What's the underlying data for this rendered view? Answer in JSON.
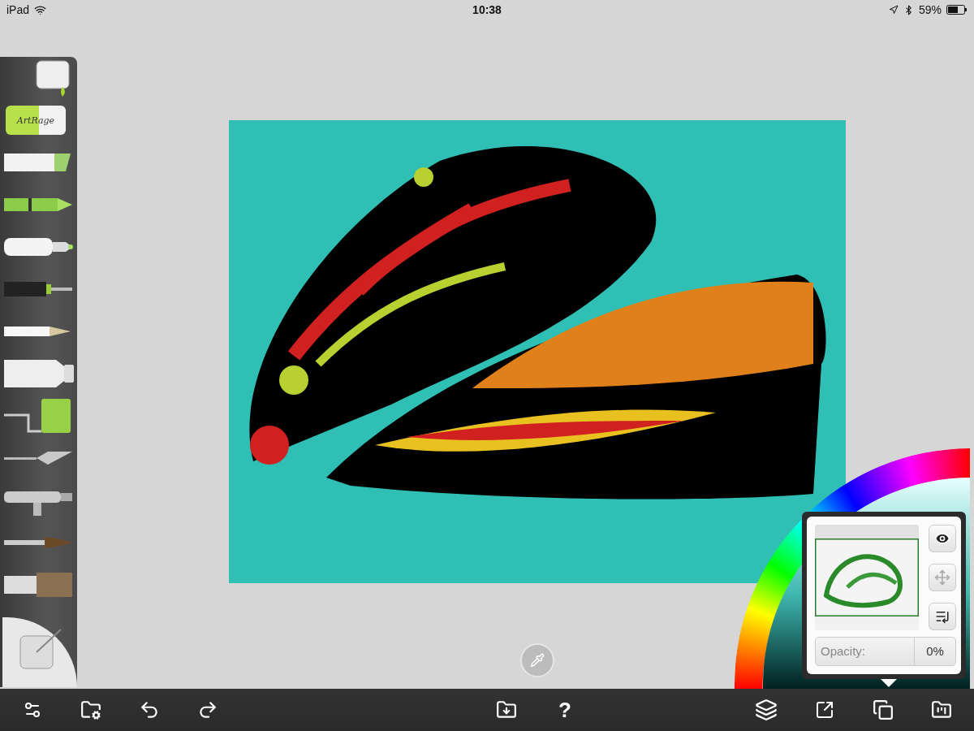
{
  "status_bar": {
    "device": "iPad",
    "time": "10:38",
    "battery": "59%"
  },
  "tools": [
    {
      "kind": "bucket"
    },
    {
      "kind": "eraser",
      "label": "ArtRage"
    },
    {
      "kind": "chalk"
    },
    {
      "kind": "crayon"
    },
    {
      "kind": "marker"
    },
    {
      "kind": "pen"
    },
    {
      "kind": "pencil"
    },
    {
      "kind": "tube"
    },
    {
      "kind": "roller"
    },
    {
      "kind": "knife"
    },
    {
      "kind": "airbrush"
    },
    {
      "kind": "brush"
    },
    {
      "kind": "flatbrush"
    }
  ],
  "layer_panel": {
    "visible": true,
    "opacity_label": "Opacity:",
    "opacity_value": "0%"
  },
  "bottom_toolbar": {
    "left": [
      {
        "kind": "settings"
      },
      {
        "kind": "gallery"
      },
      {
        "kind": "undo"
      },
      {
        "kind": "redo"
      }
    ],
    "center": [
      {
        "kind": "import"
      },
      {
        "kind": "help",
        "label": "?"
      }
    ],
    "right": [
      {
        "kind": "layers"
      },
      {
        "kind": "share"
      },
      {
        "kind": "layer-panel"
      },
      {
        "kind": "save"
      }
    ]
  }
}
